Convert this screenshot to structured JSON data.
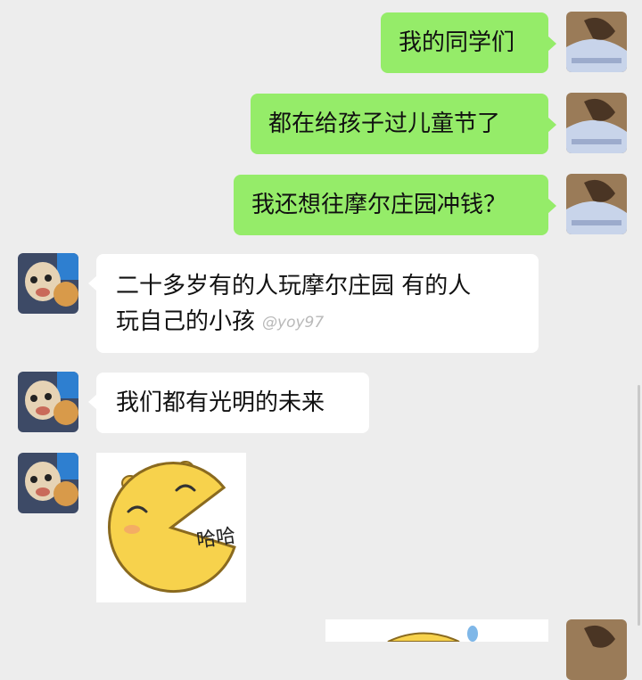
{
  "messages": [
    {
      "side": "right",
      "text": "我的同学们"
    },
    {
      "side": "right",
      "text": "都在给孩子过儿童节了"
    },
    {
      "side": "right",
      "text": "我还想往摩尔庄园冲钱？"
    },
    {
      "side": "left",
      "line1": "二十多岁有的人玩摩尔庄园 有的人",
      "line2": "玩自己的小孩",
      "watermark": "@yoy97"
    },
    {
      "side": "left",
      "text": "我们都有光明的未来"
    },
    {
      "side": "left",
      "sticker": "pacman-laugh",
      "sticker_text": "哈哈"
    }
  ],
  "colors": {
    "sent_bubble": "#95ec69",
    "received_bubble": "#ffffff",
    "background": "#ededed"
  }
}
